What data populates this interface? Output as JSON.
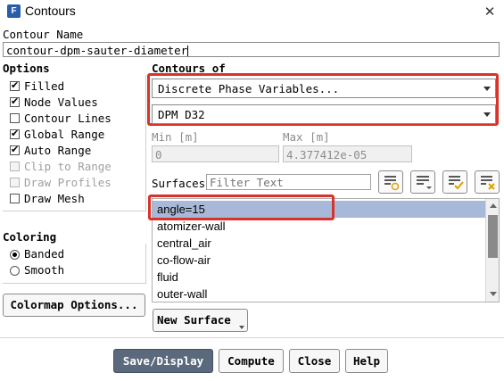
{
  "window": {
    "title": "Contours",
    "app_icon": "F"
  },
  "contour_name": {
    "label": "Contour Name",
    "value": "contour-dpm-sauter-diameter"
  },
  "options": {
    "label": "Options",
    "items": [
      {
        "label": "Filled",
        "checked": true,
        "enabled": true
      },
      {
        "label": "Node Values",
        "checked": true,
        "enabled": true
      },
      {
        "label": "Contour Lines",
        "checked": false,
        "enabled": true
      },
      {
        "label": "Global Range",
        "checked": true,
        "enabled": true
      },
      {
        "label": "Auto Range",
        "checked": true,
        "enabled": true
      },
      {
        "label": "Clip to Range",
        "checked": false,
        "enabled": false
      },
      {
        "label": "Draw Profiles",
        "checked": false,
        "enabled": false
      },
      {
        "label": "Draw Mesh",
        "checked": false,
        "enabled": true
      }
    ]
  },
  "coloring": {
    "label": "Coloring",
    "options": [
      {
        "label": "Banded",
        "selected": true
      },
      {
        "label": "Smooth",
        "selected": false
      }
    ]
  },
  "colormap_button": "Colormap Options...",
  "contours_of": {
    "label": "Contours of",
    "category": "Discrete Phase Variables...",
    "variable": "DPM D32"
  },
  "range": {
    "min_label": "Min [m]",
    "min_value": "0",
    "max_label": "Max [m]",
    "max_value": "4.377412e-05"
  },
  "surfaces": {
    "label": "Surfaces",
    "filter_placeholder": "Filter Text",
    "items": [
      "angle=15",
      "atomizer-wall",
      "central_air",
      "co-flow-air",
      "fluid",
      "outer-wall"
    ],
    "selected_index": 0
  },
  "new_surface_button": "New Surface",
  "buttons": {
    "save_display": "Save/Display",
    "compute": "Compute",
    "close": "Close",
    "help": "Help"
  },
  "colors": {
    "highlight": "#d8322a",
    "selection": "#a8b8d8",
    "primary_button": "#5a6a7c"
  }
}
